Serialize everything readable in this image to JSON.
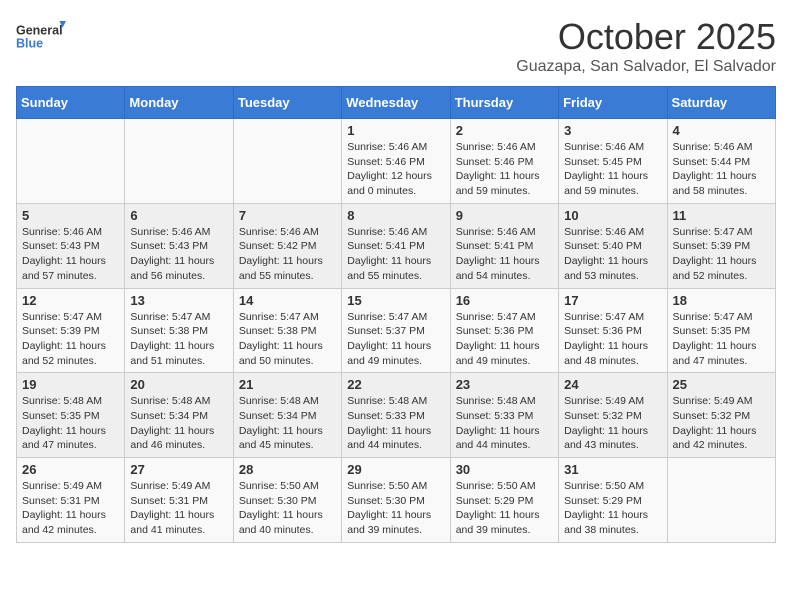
{
  "header": {
    "logo_general": "General",
    "logo_blue": "Blue",
    "month": "October 2025",
    "location": "Guazapa, San Salvador, El Salvador"
  },
  "days_of_week": [
    "Sunday",
    "Monday",
    "Tuesday",
    "Wednesday",
    "Thursday",
    "Friday",
    "Saturday"
  ],
  "weeks": [
    [
      {
        "day": "",
        "sunrise": "",
        "sunset": "",
        "daylight": ""
      },
      {
        "day": "",
        "sunrise": "",
        "sunset": "",
        "daylight": ""
      },
      {
        "day": "",
        "sunrise": "",
        "sunset": "",
        "daylight": ""
      },
      {
        "day": "1",
        "sunrise": "Sunrise: 5:46 AM",
        "sunset": "Sunset: 5:46 PM",
        "daylight": "Daylight: 12 hours and 0 minutes."
      },
      {
        "day": "2",
        "sunrise": "Sunrise: 5:46 AM",
        "sunset": "Sunset: 5:46 PM",
        "daylight": "Daylight: 11 hours and 59 minutes."
      },
      {
        "day": "3",
        "sunrise": "Sunrise: 5:46 AM",
        "sunset": "Sunset: 5:45 PM",
        "daylight": "Daylight: 11 hours and 59 minutes."
      },
      {
        "day": "4",
        "sunrise": "Sunrise: 5:46 AM",
        "sunset": "Sunset: 5:44 PM",
        "daylight": "Daylight: 11 hours and 58 minutes."
      }
    ],
    [
      {
        "day": "5",
        "sunrise": "Sunrise: 5:46 AM",
        "sunset": "Sunset: 5:43 PM",
        "daylight": "Daylight: 11 hours and 57 minutes."
      },
      {
        "day": "6",
        "sunrise": "Sunrise: 5:46 AM",
        "sunset": "Sunset: 5:43 PM",
        "daylight": "Daylight: 11 hours and 56 minutes."
      },
      {
        "day": "7",
        "sunrise": "Sunrise: 5:46 AM",
        "sunset": "Sunset: 5:42 PM",
        "daylight": "Daylight: 11 hours and 55 minutes."
      },
      {
        "day": "8",
        "sunrise": "Sunrise: 5:46 AM",
        "sunset": "Sunset: 5:41 PM",
        "daylight": "Daylight: 11 hours and 55 minutes."
      },
      {
        "day": "9",
        "sunrise": "Sunrise: 5:46 AM",
        "sunset": "Sunset: 5:41 PM",
        "daylight": "Daylight: 11 hours and 54 minutes."
      },
      {
        "day": "10",
        "sunrise": "Sunrise: 5:46 AM",
        "sunset": "Sunset: 5:40 PM",
        "daylight": "Daylight: 11 hours and 53 minutes."
      },
      {
        "day": "11",
        "sunrise": "Sunrise: 5:47 AM",
        "sunset": "Sunset: 5:39 PM",
        "daylight": "Daylight: 11 hours and 52 minutes."
      }
    ],
    [
      {
        "day": "12",
        "sunrise": "Sunrise: 5:47 AM",
        "sunset": "Sunset: 5:39 PM",
        "daylight": "Daylight: 11 hours and 52 minutes."
      },
      {
        "day": "13",
        "sunrise": "Sunrise: 5:47 AM",
        "sunset": "Sunset: 5:38 PM",
        "daylight": "Daylight: 11 hours and 51 minutes."
      },
      {
        "day": "14",
        "sunrise": "Sunrise: 5:47 AM",
        "sunset": "Sunset: 5:38 PM",
        "daylight": "Daylight: 11 hours and 50 minutes."
      },
      {
        "day": "15",
        "sunrise": "Sunrise: 5:47 AM",
        "sunset": "Sunset: 5:37 PM",
        "daylight": "Daylight: 11 hours and 49 minutes."
      },
      {
        "day": "16",
        "sunrise": "Sunrise: 5:47 AM",
        "sunset": "Sunset: 5:36 PM",
        "daylight": "Daylight: 11 hours and 49 minutes."
      },
      {
        "day": "17",
        "sunrise": "Sunrise: 5:47 AM",
        "sunset": "Sunset: 5:36 PM",
        "daylight": "Daylight: 11 hours and 48 minutes."
      },
      {
        "day": "18",
        "sunrise": "Sunrise: 5:47 AM",
        "sunset": "Sunset: 5:35 PM",
        "daylight": "Daylight: 11 hours and 47 minutes."
      }
    ],
    [
      {
        "day": "19",
        "sunrise": "Sunrise: 5:48 AM",
        "sunset": "Sunset: 5:35 PM",
        "daylight": "Daylight: 11 hours and 47 minutes."
      },
      {
        "day": "20",
        "sunrise": "Sunrise: 5:48 AM",
        "sunset": "Sunset: 5:34 PM",
        "daylight": "Daylight: 11 hours and 46 minutes."
      },
      {
        "day": "21",
        "sunrise": "Sunrise: 5:48 AM",
        "sunset": "Sunset: 5:34 PM",
        "daylight": "Daylight: 11 hours and 45 minutes."
      },
      {
        "day": "22",
        "sunrise": "Sunrise: 5:48 AM",
        "sunset": "Sunset: 5:33 PM",
        "daylight": "Daylight: 11 hours and 44 minutes."
      },
      {
        "day": "23",
        "sunrise": "Sunrise: 5:48 AM",
        "sunset": "Sunset: 5:33 PM",
        "daylight": "Daylight: 11 hours and 44 minutes."
      },
      {
        "day": "24",
        "sunrise": "Sunrise: 5:49 AM",
        "sunset": "Sunset: 5:32 PM",
        "daylight": "Daylight: 11 hours and 43 minutes."
      },
      {
        "day": "25",
        "sunrise": "Sunrise: 5:49 AM",
        "sunset": "Sunset: 5:32 PM",
        "daylight": "Daylight: 11 hours and 42 minutes."
      }
    ],
    [
      {
        "day": "26",
        "sunrise": "Sunrise: 5:49 AM",
        "sunset": "Sunset: 5:31 PM",
        "daylight": "Daylight: 11 hours and 42 minutes."
      },
      {
        "day": "27",
        "sunrise": "Sunrise: 5:49 AM",
        "sunset": "Sunset: 5:31 PM",
        "daylight": "Daylight: 11 hours and 41 minutes."
      },
      {
        "day": "28",
        "sunrise": "Sunrise: 5:50 AM",
        "sunset": "Sunset: 5:30 PM",
        "daylight": "Daylight: 11 hours and 40 minutes."
      },
      {
        "day": "29",
        "sunrise": "Sunrise: 5:50 AM",
        "sunset": "Sunset: 5:30 PM",
        "daylight": "Daylight: 11 hours and 39 minutes."
      },
      {
        "day": "30",
        "sunrise": "Sunrise: 5:50 AM",
        "sunset": "Sunset: 5:29 PM",
        "daylight": "Daylight: 11 hours and 39 minutes."
      },
      {
        "day": "31",
        "sunrise": "Sunrise: 5:50 AM",
        "sunset": "Sunset: 5:29 PM",
        "daylight": "Daylight: 11 hours and 38 minutes."
      },
      {
        "day": "",
        "sunrise": "",
        "sunset": "",
        "daylight": ""
      }
    ]
  ]
}
